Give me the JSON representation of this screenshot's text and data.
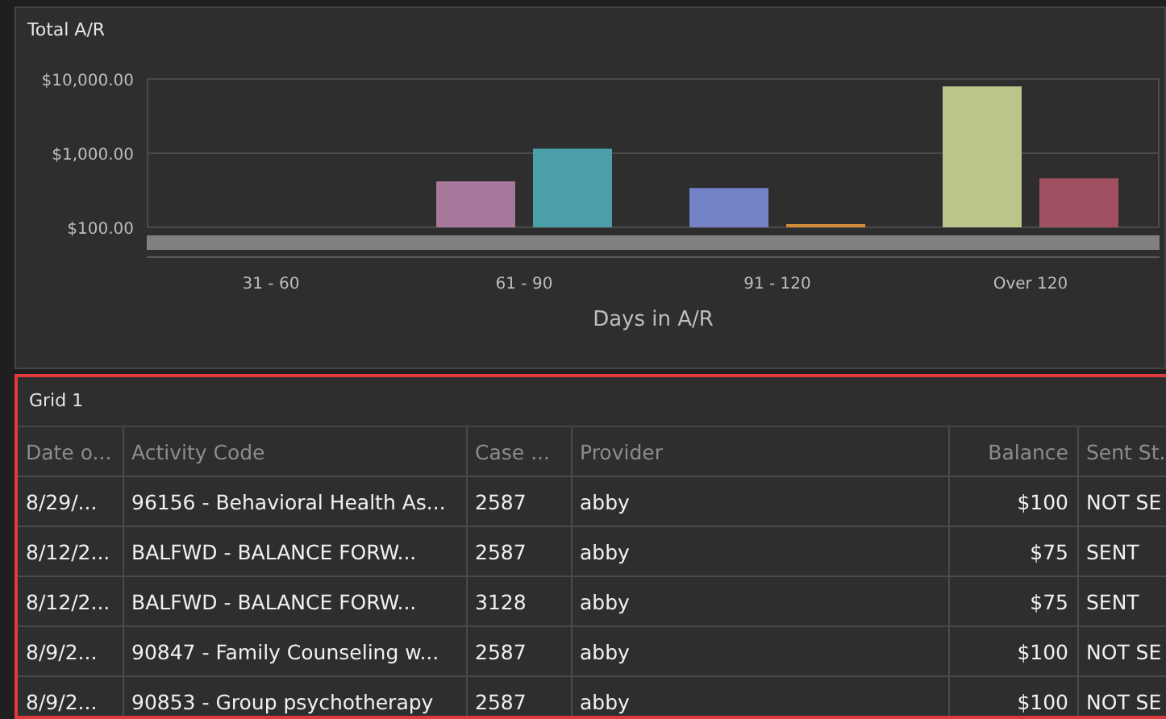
{
  "chart_panel": {
    "title": "Total A/R",
    "y_axis_labels": [
      "$10,000.00",
      "$1,000.00",
      "$100.00"
    ],
    "groups": [
      {
        "label": "31 - 60"
      },
      {
        "label": "61 - 90",
        "bars": [
          {
            "color": "#a8789c"
          },
          {
            "color": "#4a9fa8"
          }
        ]
      },
      {
        "label": "91 - 120",
        "bars": [
          {
            "color": "#7482c8"
          },
          {
            "color": "#d08a3a"
          }
        ]
      },
      {
        "label": "Over 120",
        "bars": [
          {
            "color": "#bcc48a"
          },
          {
            "color": "#a05060"
          }
        ]
      }
    ],
    "x_axis_title": "Days in A/R"
  },
  "grid": {
    "title": "Grid 1",
    "selected": true,
    "columns": [
      {
        "label": "Date o...",
        "numeric": false
      },
      {
        "label": "Activity Code",
        "numeric": false
      },
      {
        "label": "Case ...",
        "numeric": false
      },
      {
        "label": "Provider",
        "numeric": false
      },
      {
        "label": "Balance",
        "numeric": true
      },
      {
        "label": "Sent St.",
        "numeric": false
      }
    ],
    "rows": [
      [
        "8/29/...",
        "96156 - Behavioral Health As...",
        "2587",
        "abby",
        "$100",
        "NOT SE"
      ],
      [
        "8/12/2...",
        "BALFWD - BALANCE FORW...",
        "2587",
        "abby",
        "$75",
        "SENT"
      ],
      [
        "8/12/2...",
        "BALFWD - BALANCE FORW...",
        "3128",
        "abby",
        "$75",
        "SENT"
      ],
      [
        "8/9/2...",
        "90847 - Family Counseling w...",
        "2587",
        "abby",
        "$100",
        "NOT SE"
      ],
      [
        "8/9/2...",
        "90853 - Group psychotherapy",
        "2587",
        "abby",
        "$100",
        "NOT SE"
      ]
    ]
  }
}
